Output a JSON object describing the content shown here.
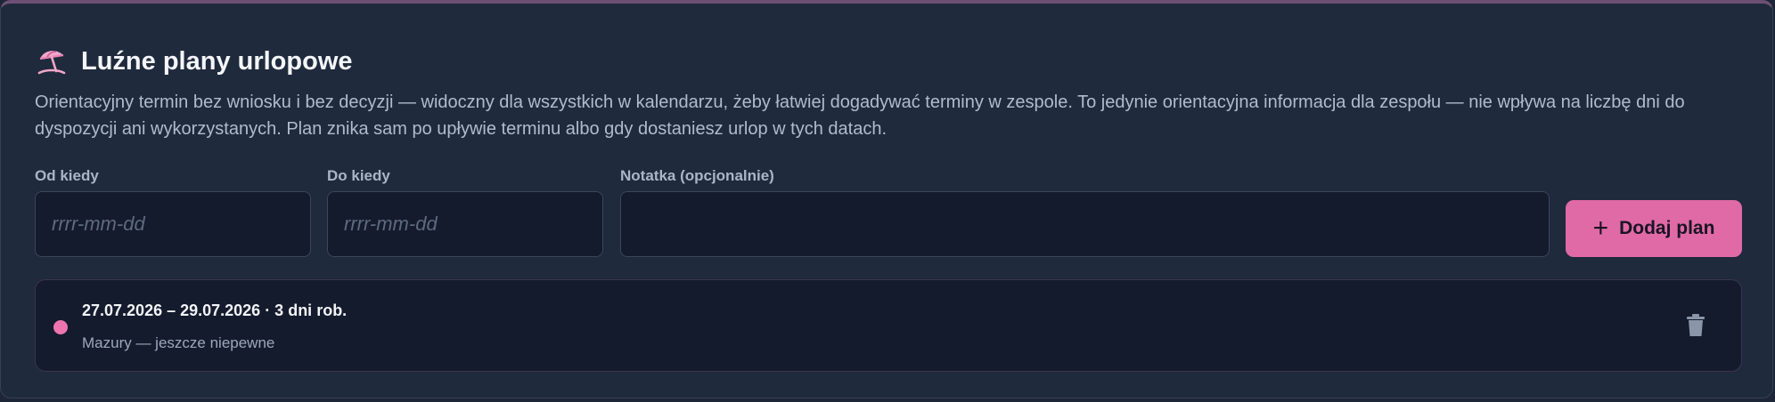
{
  "section": {
    "icon": "beach-umbrella-icon",
    "title": "Luźne plany urlopowe",
    "description": "Orientacyjny termin bez wniosku i bez decyzji — widoczny dla wszystkich w kalendarzu, żeby łatwiej dogadywać terminy w zespole. To jedynie orientacyjna informacja dla zespołu — nie wpływa na liczbę dni do dyspozycji ani wykorzystanych. Plan znika sam po upływie terminu albo gdy dostaniesz urlop w tych datach."
  },
  "form": {
    "from": {
      "label": "Od kiedy",
      "placeholder": "rrrr-mm-dd",
      "value": ""
    },
    "to": {
      "label": "Do kiedy",
      "placeholder": "rrrr-mm-dd",
      "value": ""
    },
    "note": {
      "label": "Notatka (opcjonalnie)",
      "placeholder": "",
      "value": ""
    },
    "add_button": {
      "icon": "plus-icon",
      "label": "Dodaj plan"
    }
  },
  "plans": [
    {
      "range": "27.07.2026 – 29.07.2026 · 3 dni rob.",
      "note": "Mazury — jeszcze niepewne",
      "delete_icon": "trash-icon"
    }
  ],
  "colors": {
    "accent": "#e06aa6",
    "dot": "#ee74b0",
    "background": "#1f2a3c"
  }
}
